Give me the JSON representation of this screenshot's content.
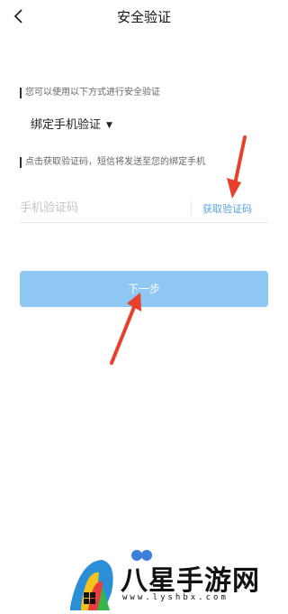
{
  "header": {
    "title": "安全验证"
  },
  "section1": {
    "label": "您可以使用以下方式进行安全验证"
  },
  "method": {
    "selected": "绑定手机验证"
  },
  "section2": {
    "label": "点击获取验证码，短信将发送至您的绑定手机"
  },
  "code": {
    "placeholder": "手机验证码",
    "get_code_label": "获取验证码"
  },
  "next": {
    "label": "下一步"
  },
  "watermark": {
    "title": "八星手游网",
    "url": "www.lyshbx.com"
  },
  "colors": {
    "accent": "#5aa3e6",
    "button": "#8dc7f2",
    "arrow": "#e8402a"
  }
}
